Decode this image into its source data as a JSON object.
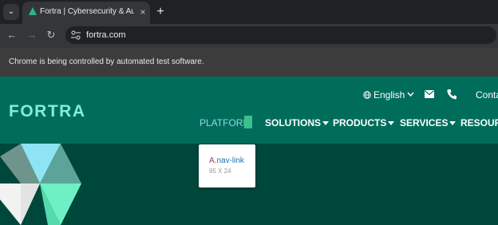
{
  "browser": {
    "tab": {
      "title": "Fortra | Cybersecurity & Automa",
      "close_glyph": "×",
      "favicon": "fortra-favicon-icon"
    },
    "tab_menu_glyph": "⌄",
    "new_tab_glyph": "+",
    "toolbar": {
      "back_glyph": "←",
      "forward_glyph": "→",
      "reload_glyph": "↻",
      "url": "fortra.com"
    },
    "infobar": {
      "text": "Chrome is being controlled by automated test software."
    }
  },
  "site": {
    "logo_text": "FORTRA",
    "utility": {
      "language": "English",
      "contact": "Conta"
    },
    "nav": {
      "platform": "PLATFORM",
      "solutions": "SOLUTIONS",
      "products": "PRODUCTS",
      "services": "SERVICES",
      "resources": "RESOURC"
    }
  },
  "inspector_tooltip": {
    "tag": "A",
    "class": ".nav-link",
    "size": "95 X 24"
  },
  "colors": {
    "header_bg": "#006d5b",
    "hero_bg": "#00473b",
    "logo": "#7ff0d5",
    "platform_text": "#8fd8e8",
    "highlight": "#3cbf8e"
  }
}
